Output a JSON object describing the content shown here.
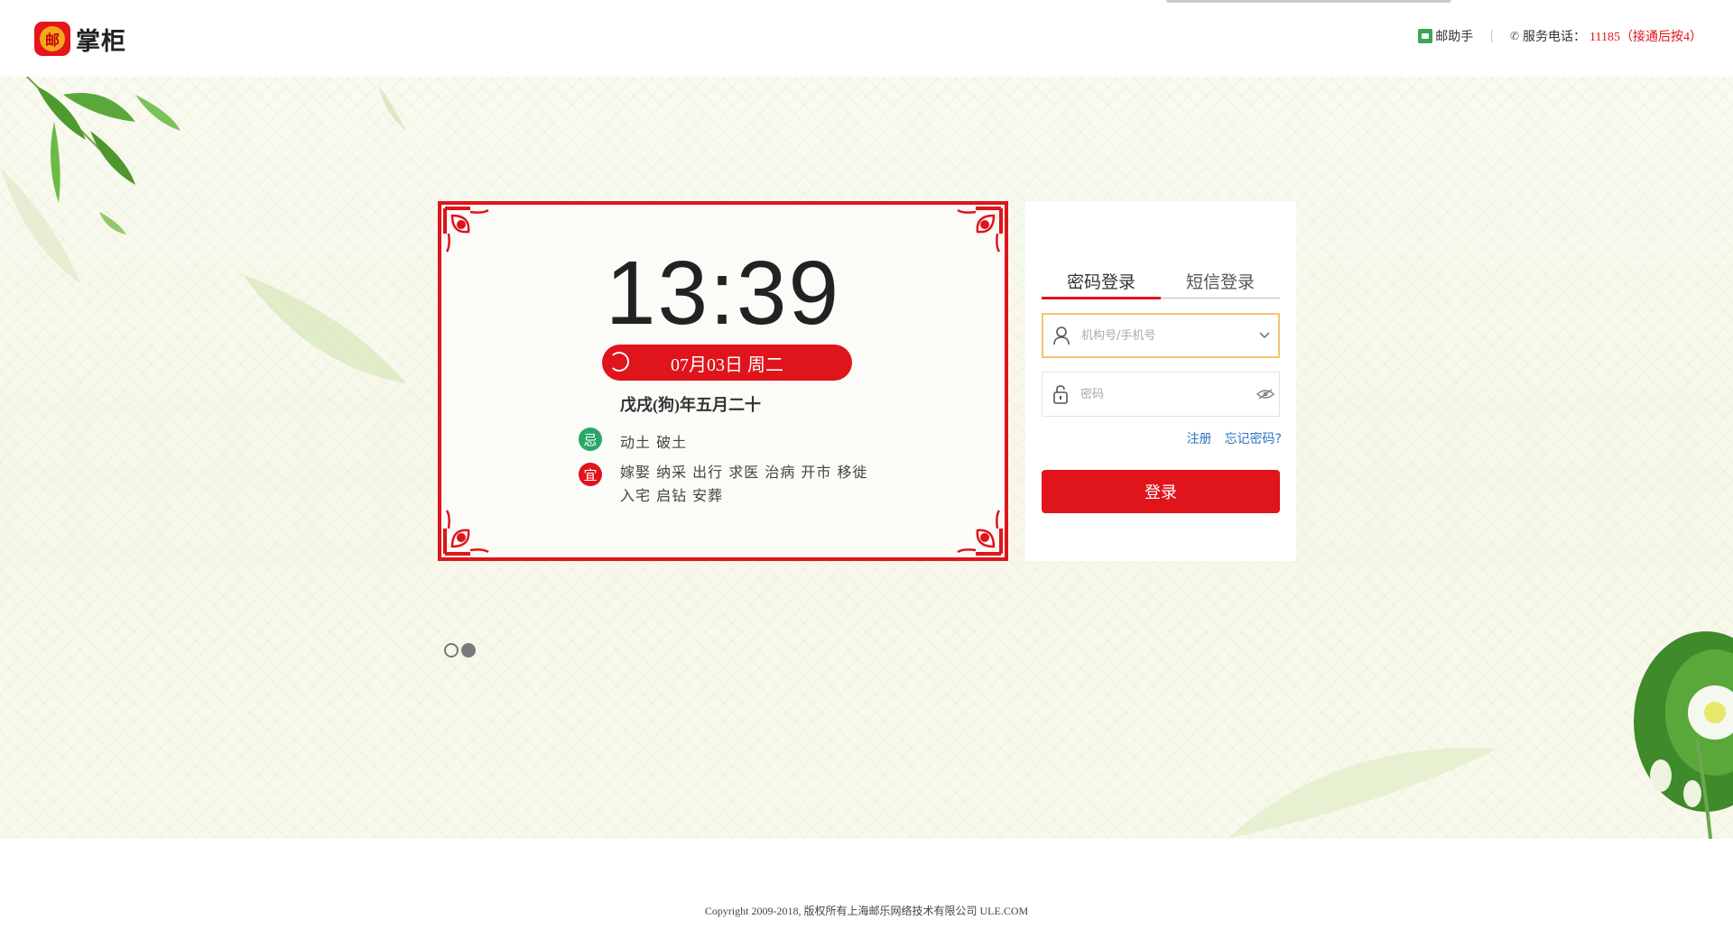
{
  "header": {
    "logo_glyph": "邮",
    "logo_text": "掌柜",
    "assistant_label": "邮助手",
    "separator": "|",
    "service_label": "服务电话：",
    "service_phone": "11185（接通后按4）"
  },
  "calendar": {
    "time": "13:39",
    "date": "07月03日 周二",
    "lunar_date": "戊戌(狗)年五月二十",
    "avoid_badge": "忌",
    "avoid_items": "动土 破土",
    "good_badge": "宜",
    "good_items_line1": "嫁娶 纳采 出行 求医 治病 开市 移徙",
    "good_items_line2": "入宅 启钻 安葬",
    "carousel_active_index": 1,
    "carousel_count": 2
  },
  "login": {
    "tabs": [
      {
        "label": "密码登录",
        "active": true
      },
      {
        "label": "短信登录",
        "active": false
      }
    ],
    "account_placeholder": "机构号/手机号",
    "password_placeholder": "密码",
    "register_link": "注册",
    "forgot_link": "忘记密码?",
    "submit_label": "登录"
  },
  "footer": {
    "copyright": "Copyright 2009-2018, 版权所有上海邮乐网络技术有限公司 ULE.COM"
  },
  "colors": {
    "brand_red": "#e0141b",
    "link_blue": "#2e73c6",
    "avoid_green": "#2aa86a",
    "focus_border": "#f3c56e"
  }
}
